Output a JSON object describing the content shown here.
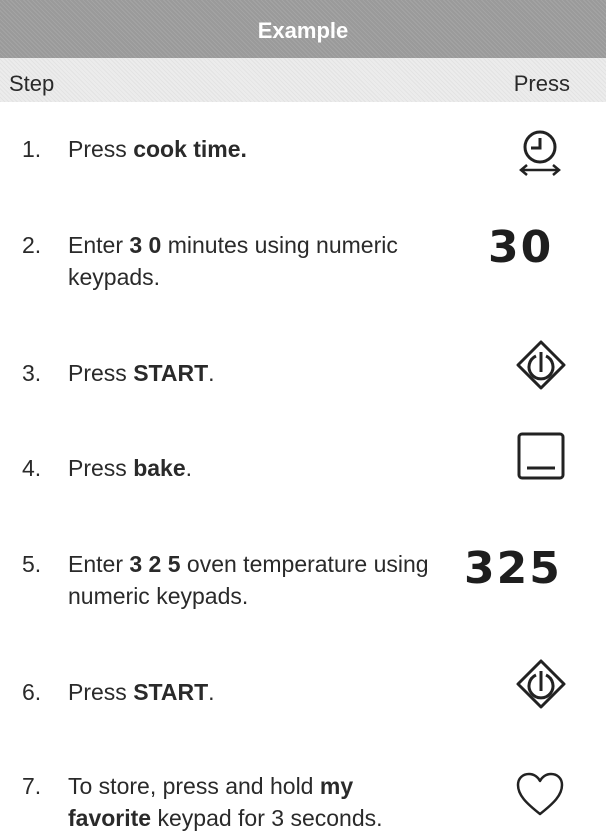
{
  "header": {
    "title": "Example",
    "step_label": "Step",
    "press_label": "Press"
  },
  "steps": [
    {
      "num": "1.",
      "t1": "Press ",
      "b1": "cook time.",
      "t2": "",
      "b2": "",
      "t3": "",
      "icon": "clock-timer-icon"
    },
    {
      "num": "2.",
      "t1": "Enter ",
      "b1": "3 0",
      "t2": " minutes using numeric keypads.",
      "b2": "",
      "t3": "",
      "press_value": "30"
    },
    {
      "num": "3.",
      "t1": "Press ",
      "b1": "START",
      "t2": ".",
      "b2": "",
      "t3": "",
      "icon": "start-diamond-icon"
    },
    {
      "num": "4.",
      "t1": "Press ",
      "b1": "bake",
      "t2": ".",
      "b2": "",
      "t3": "",
      "icon": "bake-square-icon"
    },
    {
      "num": "5.",
      "t1": "Enter ",
      "b1": "3 2 5",
      "t2": " oven temperature using numeric keypads.",
      "b2": "",
      "t3": "",
      "press_value": "325"
    },
    {
      "num": "6.",
      "t1": "Press ",
      "b1": "START",
      "t2": ".",
      "b2": "",
      "t3": "",
      "icon": "start-diamond-icon"
    },
    {
      "num": "7.",
      "t1": "To store, press and hold ",
      "b1": "my favorite",
      "t2": " keypad for 3 seconds.",
      "b2": "",
      "t3": "",
      "icon": "heart-outline-icon"
    }
  ]
}
